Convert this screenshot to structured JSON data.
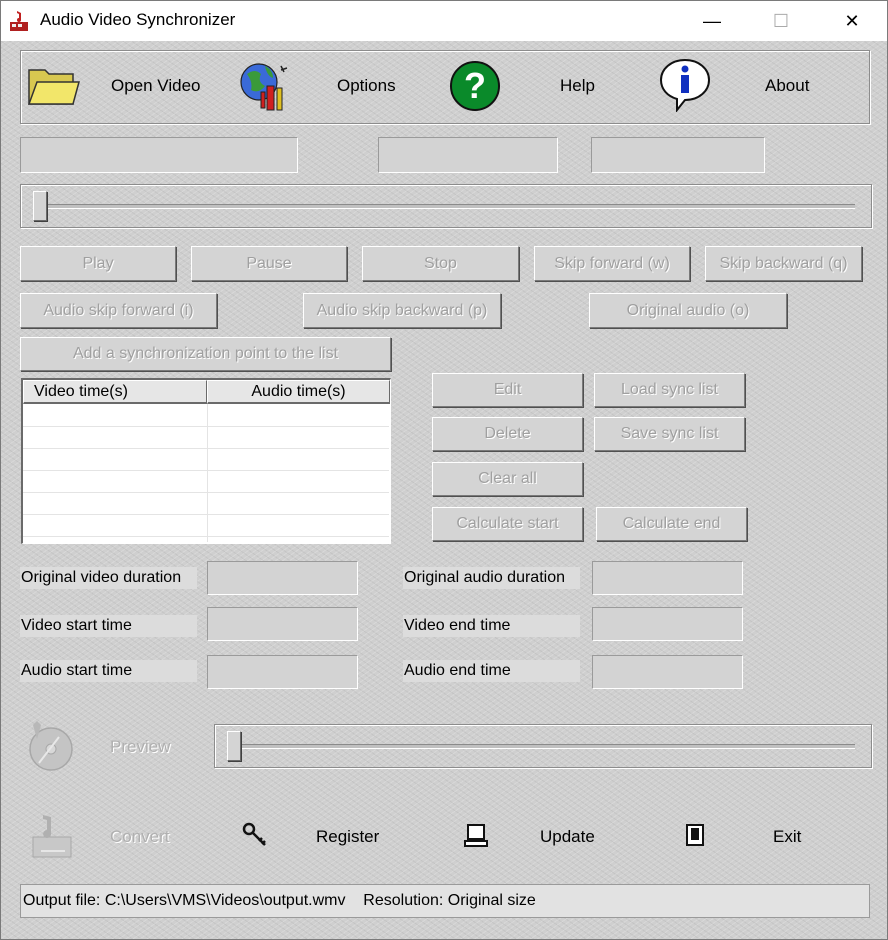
{
  "window": {
    "title": "Audio Video Synchronizer",
    "minimize": "—",
    "maximize": "☐",
    "close": "✕"
  },
  "toolbar": {
    "open_video": "Open Video",
    "options": "Options",
    "help": "Help",
    "about": "About"
  },
  "info_fields": {
    "file": "",
    "time1": "",
    "time2": ""
  },
  "video_slider": {
    "value": 0
  },
  "controls": {
    "play": "Play",
    "pause": "Pause",
    "stop": "Stop",
    "skip_forward": "Skip forward (w)",
    "skip_backward": "Skip backward (q)",
    "audio_skip_forward": "Audio skip forward (i)",
    "audio_skip_backward": "Audio skip backward (p)",
    "original_audio": "Original audio (o)",
    "add_sync_point": "Add a synchronization point to the list"
  },
  "sync_list": {
    "columns": [
      "Video time(s)",
      "Audio time(s)"
    ],
    "rows": []
  },
  "list_actions": {
    "edit": "Edit",
    "load_sync_list": "Load sync list",
    "delete": "Delete",
    "save_sync_list": "Save sync list",
    "clear_all": "Clear all",
    "calculate_start": "Calculate start",
    "calculate_end": "Calculate end"
  },
  "durations": {
    "original_video_duration": {
      "label": "Original video duration",
      "value": ""
    },
    "original_audio_duration": {
      "label": "Original audio duration",
      "value": ""
    },
    "video_start_time": {
      "label": "Video start time",
      "value": ""
    },
    "video_end_time": {
      "label": "Video end time",
      "value": ""
    },
    "audio_start_time": {
      "label": "Audio start time",
      "value": ""
    },
    "audio_end_time": {
      "label": "Audio end time",
      "value": ""
    }
  },
  "preview": {
    "label": "Preview",
    "value": 0
  },
  "bottom": {
    "convert": "Convert",
    "register": "Register",
    "update": "Update",
    "exit": "Exit"
  },
  "status": {
    "text": "Output file: C:\\Users\\VMS\\Videos\\output.wmv    Resolution: Original size"
  },
  "colors": {
    "background": "#cfcfcf",
    "disabled_text": "#a0a0a0",
    "help_green": "#0a8a2a",
    "folder_yellow": "#f2e66a",
    "info_blue": "#1030c0"
  },
  "icons": {
    "app": "app-icon",
    "open": "folder-icon",
    "options": "globe-tools-icon",
    "help": "question-icon",
    "about": "info-icon",
    "preview": "disc-icon",
    "convert": "music-note-icon",
    "register": "key-icon",
    "update": "computer-icon",
    "exit": "door-icon"
  }
}
